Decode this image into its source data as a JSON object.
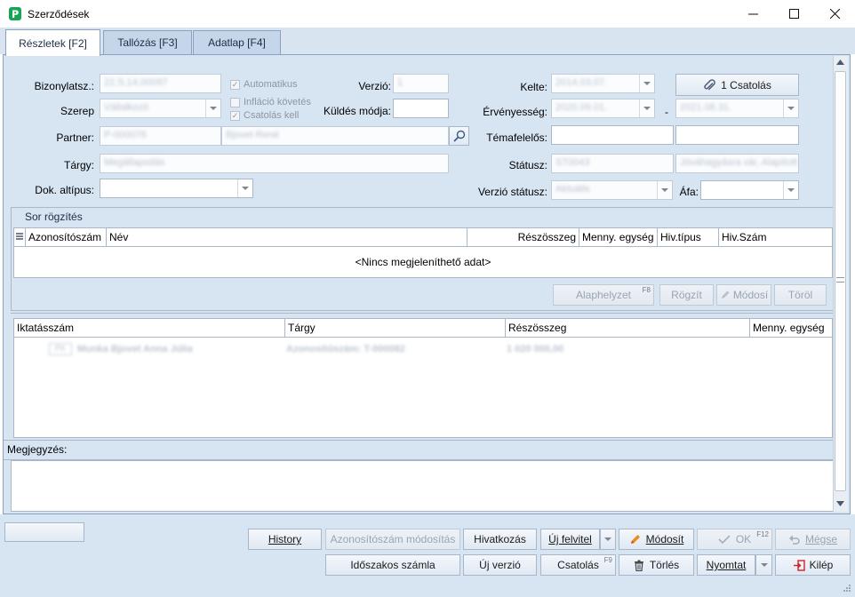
{
  "window": {
    "title": "Szerződések",
    "minimize_label": "–",
    "maximize_label": "□",
    "close_label": "×"
  },
  "tabs": [
    {
      "label": "Részletek [F2]"
    },
    {
      "label": "Tallózás [F3]"
    },
    {
      "label": "Adatlap [F4]"
    }
  ],
  "form": {
    "bizonylatsz_label": "Bizonylatsz.:",
    "bizonylatsz_value": "22.S.14.00097",
    "automatikus_label": "Automatikus",
    "inflacio_label": "Infláció követés",
    "csatolas_kell_label": "Csatolás kell",
    "verzio_label": "Verzió:",
    "verzio_value": "1",
    "kuldes_label": "Küldés módja:",
    "szerep_label": "Szerep",
    "szerep_value": "Vállalkozó",
    "partner_label": "Partner:",
    "partner_code": "P-000076",
    "partner_name": "Bjovet René",
    "targy_label": "Tárgy:",
    "targy_value": "Megállapodás",
    "dok_altipus_label": "Dok. altípus:",
    "kelte_label": "Kelte:",
    "kelte_value": "2014.03.07.",
    "ervenyesseg_label": "Érvényesség:",
    "ervenyesseg_from": "2020.09.01.",
    "ervenyesseg_sep": "-",
    "ervenyesseg_to": "2021.08.31.",
    "temafelelos_label": "Témafelelős:",
    "statusz_label": "Státusz:",
    "statusz_code": "ST0043",
    "statusz_text": "Jóváhagyásra vár, Alapított",
    "verzio_statusz_label": "Verzió státusz:",
    "verzio_statusz_value": "Aktuális",
    "afa_label": "Áfa:",
    "csatolas_button": "1 Csatolás"
  },
  "sor_rogzites": {
    "title": "Sor rögzítés",
    "columns": [
      "Azonosítószám",
      "Név",
      "Részösszeg",
      "Menny. egység",
      "Hiv.típus",
      "Hiv.Szám"
    ],
    "empty_text": "<Nincs megjeleníthető adat>",
    "buttons": {
      "alaphelyzet": "Alaphelyzet",
      "alaphelyzet_key": "F8",
      "rogzit": "Rögzít",
      "modosit": "Módosí",
      "torol": "Töröl"
    }
  },
  "iktatas_grid": {
    "columns": [
      "Iktatásszám",
      "Tárgy",
      "Részösszeg",
      "Menny. egység"
    ],
    "rows": [
      {
        "iktatasszam": "PK",
        "nev": "Munka Bjovet Anna Júlia",
        "targy": "Azonosítószám: T-000082",
        "reszosszeg": "1 020 000,00"
      }
    ]
  },
  "megjegyzes": {
    "label": "Megjegyzés:"
  },
  "toolbar": {
    "history": "History",
    "azonosito_modositas": "Azonosítószám módosítás",
    "hivatkozas": "Hivatkozás",
    "uj_felvitel": "Új felvitel",
    "modosit": "Módosít",
    "ok": "OK",
    "ok_key": "F12",
    "megse": "Mégse",
    "idoszakos_szamla": "Időszakos számla",
    "uj_verzio": "Új verzió",
    "csatolas": "Csatolás",
    "csatolas_key": "F9",
    "torles": "Törlés",
    "nyomtat": "Nyomtat",
    "kilep": "Kilép"
  },
  "colors": {
    "accent": "#16a34a",
    "panel": "#d7e4f2",
    "border": "#8aa2c0"
  }
}
